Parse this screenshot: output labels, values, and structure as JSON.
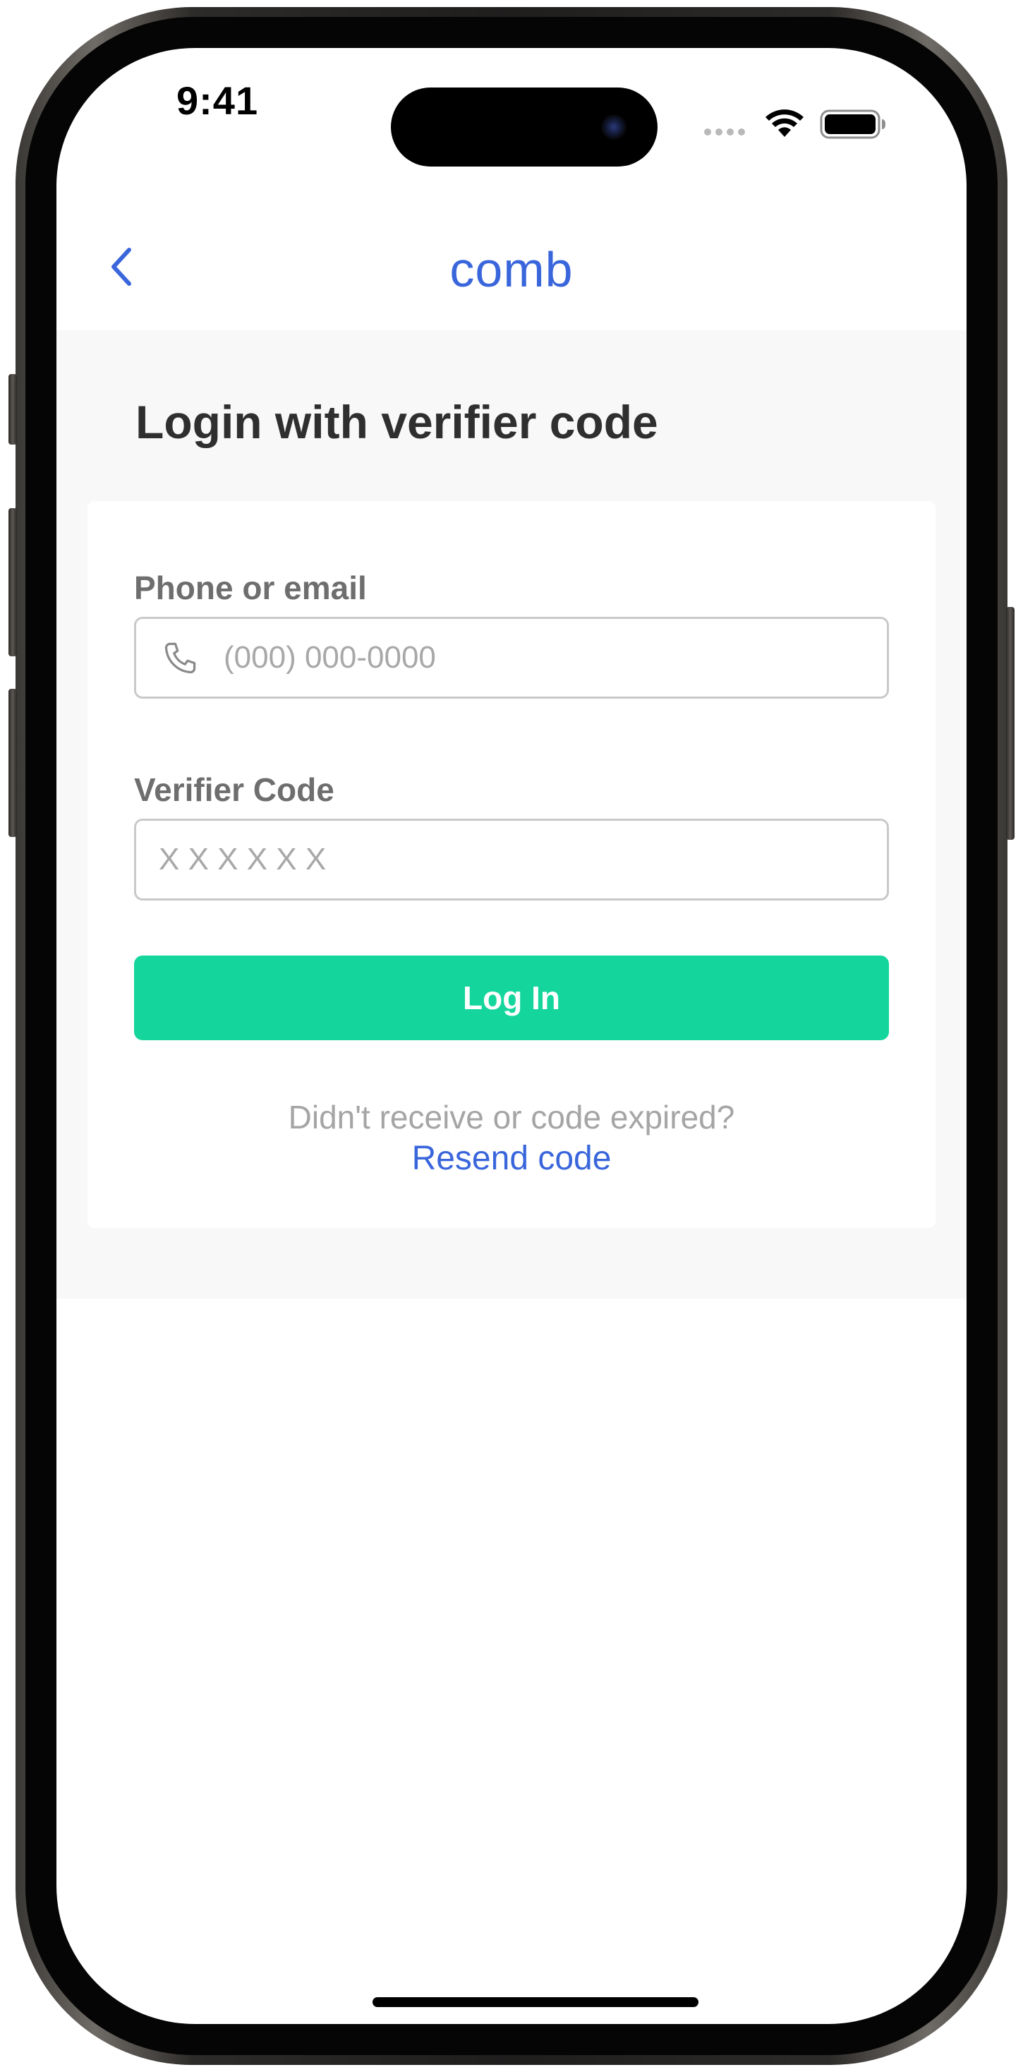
{
  "status_bar": {
    "time": "9:41"
  },
  "nav": {
    "back_icon": "chevron-left-icon",
    "logo_text": "comb"
  },
  "page": {
    "title": "Login with verifier code"
  },
  "form": {
    "phone": {
      "label": "Phone or email",
      "placeholder": "(000) 000-0000",
      "value": "",
      "icon": "phone-icon"
    },
    "code": {
      "label": "Verifier Code",
      "placeholder": "X X X X X X",
      "value": ""
    },
    "submit_label": "Log In",
    "resend_prompt": "Didn't receive or code expired?",
    "resend_link": "Resend code"
  },
  "colors": {
    "accent_blue": "#3a66dc",
    "button_green": "#14d69c",
    "content_background": "#f8f8f8"
  }
}
